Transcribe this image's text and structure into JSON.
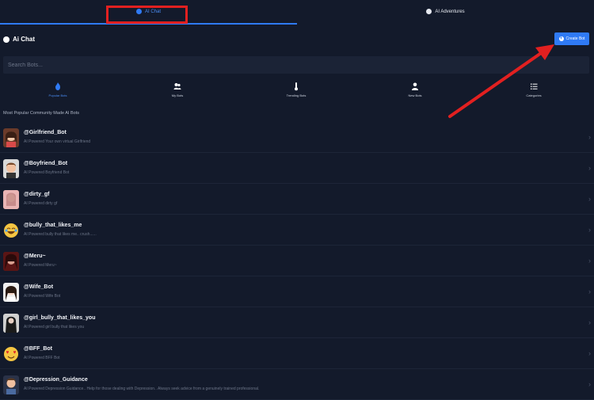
{
  "tabs": [
    {
      "label": "AI Chat",
      "active": true
    },
    {
      "label": "AI Adventures",
      "active": false
    }
  ],
  "header": {
    "title": "Ai Chat",
    "create_label": "Create Bot"
  },
  "search": {
    "placeholder": "Search Bots..."
  },
  "categories": [
    {
      "label": "Popular Bots",
      "icon": "fire-icon",
      "active": true
    },
    {
      "label": "My Bots",
      "icon": "users-icon",
      "active": false
    },
    {
      "label": "Trending Bots",
      "icon": "thermometer-icon",
      "active": false
    },
    {
      "label": "New Bots",
      "icon": "user-plus-icon",
      "active": false
    },
    {
      "label": "Categories",
      "icon": "list-icon",
      "active": false
    }
  ],
  "section_label": "Most Popular Community Made AI Bots",
  "bots": [
    {
      "name": "@Girlfriend_Bot",
      "desc": "AI Powered Your own virtual Girlfriend",
      "avatar_color": "#6b3b2a"
    },
    {
      "name": "@Boyfriend_Bot",
      "desc": "AI Powered Boyfriend Bot",
      "avatar_color": "#8a5a3a"
    },
    {
      "name": "@dirty_gf",
      "desc": "AI Powered dirty gf",
      "avatar_color": "#c98a8a"
    },
    {
      "name": "@bully_that_likes_me",
      "desc": "AI Powered bully that likes me.. crush......",
      "avatar_color": "#f5c542"
    },
    {
      "name": "@Meru~",
      "desc": "AI Powered Meru~",
      "avatar_color": "#7a1f1f"
    },
    {
      "name": "@Wife_Bot",
      "desc": "AI Powered Wife Bot",
      "avatar_color": "#e8d7cc"
    },
    {
      "name": "@girl_bully_that_likes_you",
      "desc": "AI Powered girl bully that likes you",
      "avatar_color": "#3a3a3a"
    },
    {
      "name": "@BFF_Bot",
      "desc": "AI Powered BFF Bot",
      "avatar_color": "#f5c542"
    },
    {
      "name": "@Depression_Guidance",
      "desc": "AI Powered Depression Guidance.. Help for those dealing with Depression.. Always seek advice from a genuinely trained professional.",
      "avatar_color": "#8a5a3a"
    }
  ],
  "colors": {
    "accent": "#2f7af5",
    "annotation": "#e22020",
    "background": "#131a2b"
  }
}
